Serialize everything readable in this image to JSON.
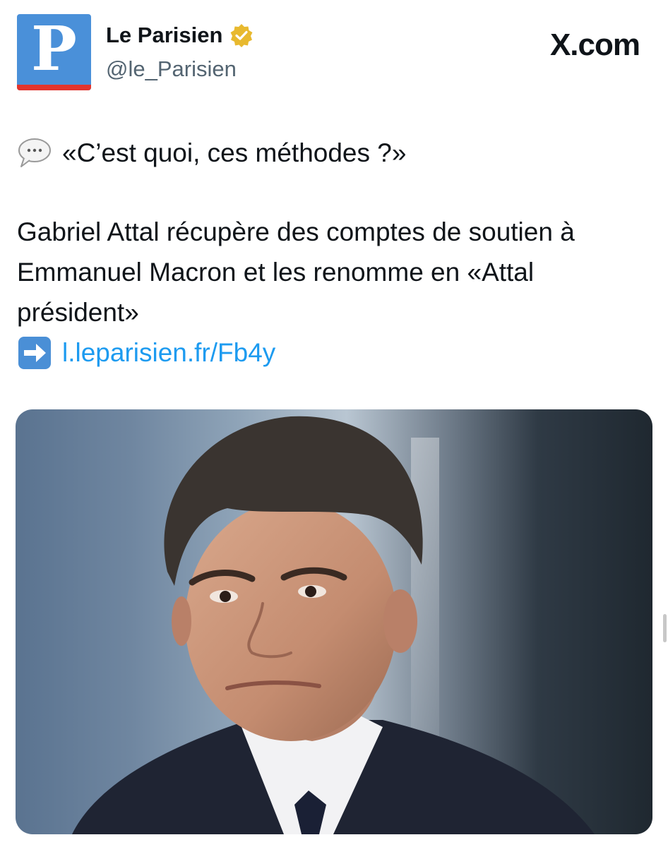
{
  "account": {
    "avatar_letter": "P",
    "name": "Le Parisien",
    "handle": "@le_Parisien",
    "verified_badge_icon": "gold-verified-badge-icon",
    "brand_color": "#4a90d9",
    "stripe_color": "#e2342d"
  },
  "site_label": "X.com",
  "tweet": {
    "quote_icon": "speech-bubble-icon",
    "quote": "«C’est quoi, ces méthodes ?»",
    "body_lines": [
      "Gabriel Attal récupère des comptes de soutien à",
      "Emmanuel Macron et les renomme en «Attal",
      "président»"
    ],
    "link_icon": "right-arrow-icon",
    "link": "l.leparisien.fr/Fb4y",
    "link_color": "#1d9bf0"
  },
  "media": {
    "type": "photo"
  }
}
